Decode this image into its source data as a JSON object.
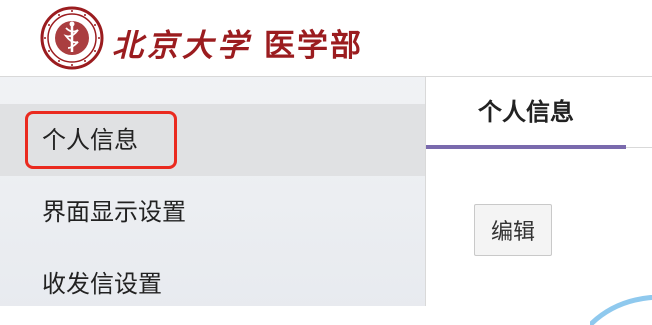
{
  "header": {
    "logo_name": "北京大学",
    "logo_sub": "医学部"
  },
  "sidebar": {
    "items": [
      {
        "label": "个人信息",
        "active": true
      },
      {
        "label": "界面显示设置",
        "active": false
      },
      {
        "label": "收发信设置",
        "active": false
      }
    ]
  },
  "main": {
    "tab_label": "个人信息",
    "edit_button": "编辑"
  },
  "colors": {
    "brand_red": "#9b1c1f",
    "highlight_red": "#ea2a1f",
    "tab_accent": "#7a6aad"
  },
  "icons": [
    "university-seal-icon"
  ]
}
